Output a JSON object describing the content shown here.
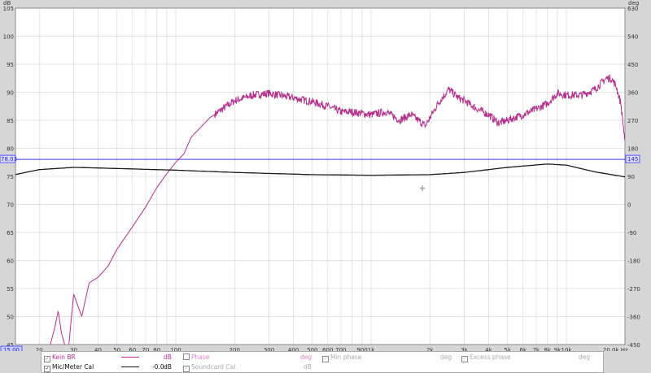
{
  "chart_data": {
    "type": "line",
    "yunit": "dB",
    "y2unit": "deg",
    "xunit": "Hz",
    "ylim": [
      45,
      105
    ],
    "y2lim": [
      -450,
      630
    ],
    "xlim": [
      15,
      20000
    ],
    "yticks": [
      45,
      50,
      55,
      60,
      65,
      70,
      75,
      80,
      85,
      90,
      95,
      100,
      105
    ],
    "y2ticks": [
      -450,
      -360,
      -270,
      -180,
      -90,
      0,
      90,
      180,
      270,
      360,
      450,
      540,
      630
    ],
    "xtick_values": [
      20,
      30,
      40,
      50,
      60,
      70,
      80,
      100,
      200,
      300,
      400,
      500,
      600,
      700,
      900,
      1000,
      2000,
      3000,
      4000,
      5000,
      6000,
      7000,
      8000,
      9000,
      10000,
      20000
    ],
    "xtick_labels": [
      "20",
      "30",
      "40",
      "50",
      "60",
      "70",
      "80",
      "100",
      "200",
      "300",
      "400",
      "500",
      "600",
      "700",
      "900",
      "1k",
      "2k",
      "3k",
      "4k",
      "5k",
      "6k",
      "7k",
      "8k",
      "9k",
      "10k",
      "20.0k Hz"
    ],
    "left_start_label": "15.00",
    "cursor": {
      "db_label": "78.03",
      "deg_label": "145",
      "value": 78.03
    },
    "grid": true,
    "series": [
      {
        "name": "Kein BR",
        "color": "#b0308a",
        "x": [
          15,
          18,
          20,
          22,
          24,
          25,
          26,
          28,
          30,
          33,
          36,
          40,
          45,
          50,
          60,
          70,
          80,
          90,
          100,
          110,
          120,
          150,
          200,
          250,
          300,
          400,
          500,
          600,
          700,
          800,
          1000,
          1200,
          1400,
          1600,
          1900,
          2200,
          2500,
          2800,
          3000,
          3500,
          4000,
          4500,
          5000,
          6000,
          7000,
          8000,
          9000,
          10000,
          12000,
          14000,
          16000,
          17000,
          18000,
          19000,
          20000
        ],
        "y": [
          40,
          42,
          45,
          43,
          48,
          51,
          47,
          43,
          54,
          50,
          56,
          57,
          59,
          62,
          66,
          69.5,
          73,
          75.5,
          77.5,
          79,
          82,
          85.5,
          88.5,
          89.5,
          89.8,
          89,
          88.3,
          87.5,
          86.5,
          86.5,
          86,
          86.5,
          85,
          86,
          84,
          88,
          90.5,
          89,
          88.5,
          87,
          86,
          84.5,
          85,
          86,
          87,
          88,
          89.8,
          89.5,
          89.5,
          90.5,
          92.5,
          92.5,
          91,
          88,
          81
        ]
      },
      {
        "name": "Mic/Meter Cal",
        "color": "#1a1a1a",
        "x": [
          15,
          20,
          30,
          50,
          100,
          200,
          500,
          1000,
          2000,
          3000,
          5000,
          8000,
          10000,
          14000,
          20000
        ],
        "y": [
          75.3,
          76.2,
          76.6,
          76.4,
          76.1,
          75.7,
          75.3,
          75.2,
          75.3,
          75.7,
          76.6,
          77.2,
          77.0,
          75.8,
          74.9
        ]
      }
    ]
  },
  "legend": {
    "rows": [
      {
        "name": "Kein BR",
        "value": "",
        "unit": "dB",
        "col2": "Phase",
        "col2_unit": "deg",
        "col3": "Min phase",
        "col3_unit": "deg",
        "col4": "Excess phase",
        "col4_unit": "deg"
      },
      {
        "name": "Mic/Meter Cal",
        "value": "-0.0",
        "unit": "dB",
        "col2": "Soundcard Cal",
        "col2_unit": "dB"
      }
    ]
  }
}
